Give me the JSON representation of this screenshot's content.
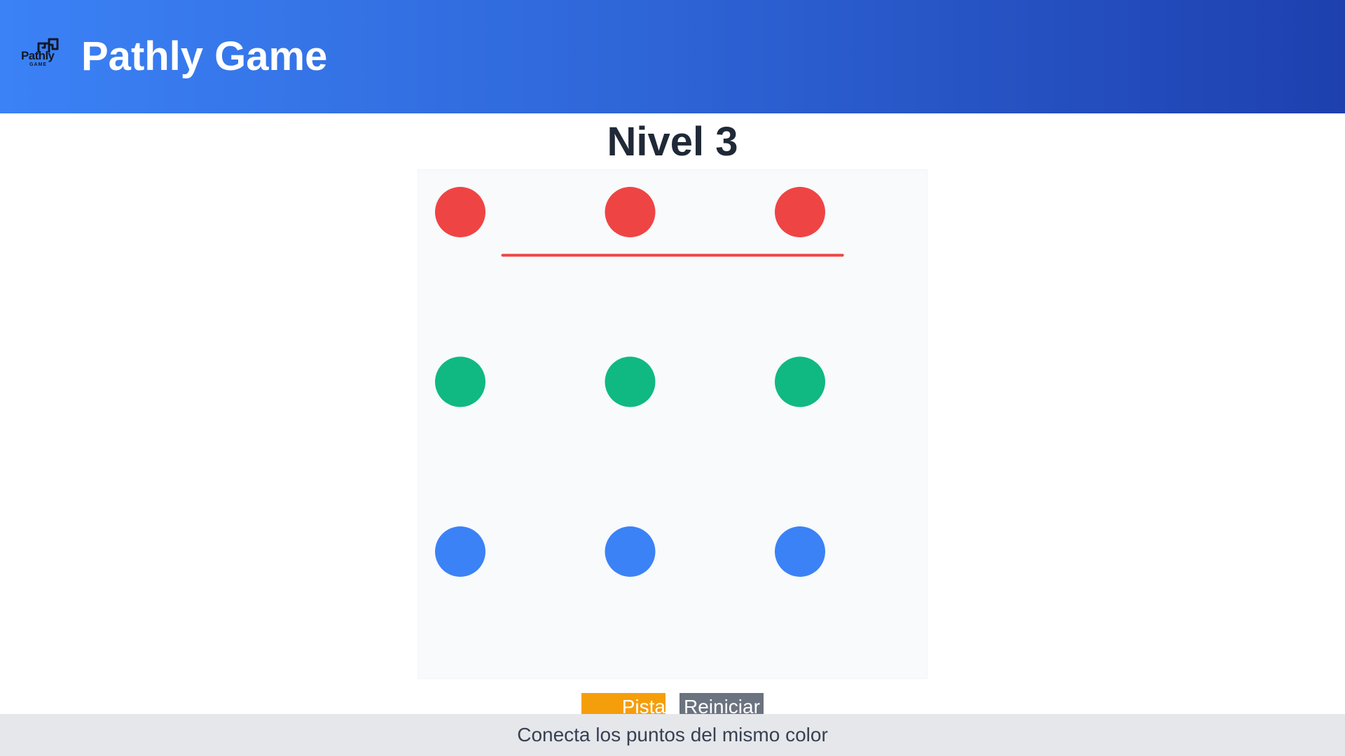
{
  "header": {
    "logo": {
      "wordmark": "Pathly",
      "subtitle": "GAME",
      "icon": "path-knot-icon"
    },
    "title": "Pathly Game"
  },
  "game": {
    "level_title": "Nivel 3",
    "board": {
      "grid_size": 3,
      "dots": [
        {
          "row": 0,
          "col": 0,
          "color_name": "red",
          "color": "#ef4444"
        },
        {
          "row": 0,
          "col": 1,
          "color_name": "red",
          "color": "#ef4444"
        },
        {
          "row": 0,
          "col": 2,
          "color_name": "red",
          "color": "#ef4444"
        },
        {
          "row": 1,
          "col": 0,
          "color_name": "green",
          "color": "#10b981"
        },
        {
          "row": 1,
          "col": 1,
          "color_name": "green",
          "color": "#10b981"
        },
        {
          "row": 1,
          "col": 2,
          "color_name": "green",
          "color": "#10b981"
        },
        {
          "row": 2,
          "col": 0,
          "color_name": "blue",
          "color": "#3b82f6"
        },
        {
          "row": 2,
          "col": 1,
          "color_name": "blue",
          "color": "#3b82f6"
        },
        {
          "row": 2,
          "col": 2,
          "color_name": "blue",
          "color": "#3b82f6"
        }
      ],
      "paths": [
        {
          "color_name": "red",
          "color": "#ef4444",
          "from": {
            "row": 0.25,
            "col": 0.25
          },
          "to": {
            "row": 0.25,
            "col": 2.25
          }
        }
      ]
    },
    "controls": {
      "hint_label": "Pista",
      "reset_label": "Reiniciar"
    }
  },
  "footer": {
    "instruction": "Conecta los puntos del mismo color"
  },
  "colors": {
    "header_start": "#3b82f6",
    "header_end": "#1e40af",
    "board_background": "#f8fafc",
    "hint_button": "#f59e0b",
    "reset_button": "#6b7280",
    "footer_background": "#e5e7eb"
  }
}
